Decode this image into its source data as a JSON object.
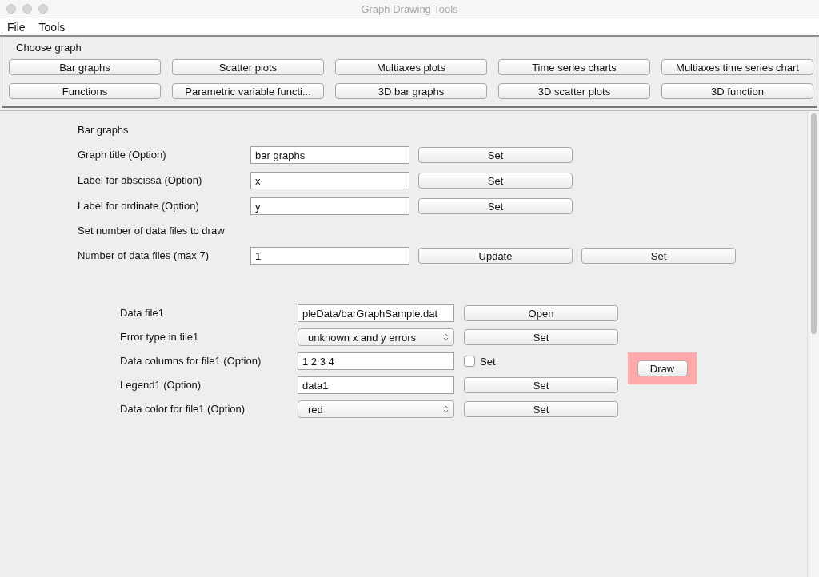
{
  "window": {
    "title": "Graph Drawing Tools"
  },
  "menu": [
    "File",
    "Tools"
  ],
  "choose_graph": {
    "heading": "Choose graph",
    "buttons": [
      "Bar graphs",
      "Scatter plots",
      "Multiaxes plots",
      "Time series charts",
      "Multiaxes time series chart",
      "Functions",
      "Parametric variable functi...",
      "3D bar graphs",
      "3D scatter plots",
      "3D function"
    ]
  },
  "settings": {
    "heading": "Bar graphs",
    "rows": [
      {
        "kind": "field",
        "label": "Graph title (Option)",
        "value": "bar graphs",
        "buttons": [
          "Set"
        ]
      },
      {
        "kind": "field",
        "label": "Label for abscissa (Option)",
        "value": "x",
        "buttons": [
          "Set"
        ]
      },
      {
        "kind": "field",
        "label": "Label for ordinate (Option)",
        "value": "y",
        "buttons": [
          "Set"
        ]
      },
      {
        "kind": "heading",
        "label": "Set number of data files to draw"
      },
      {
        "kind": "field",
        "label": "Number of data files (max 7)",
        "value": "1",
        "buttons": [
          "Update",
          "Set"
        ]
      }
    ]
  },
  "data_files": {
    "rows": [
      {
        "label": "Data file1",
        "field": {
          "kind": "text",
          "value": "pleData/barGraphSample.dat"
        },
        "control": {
          "kind": "button",
          "label": "Open"
        }
      },
      {
        "label": "Error type in file1",
        "field": {
          "kind": "select",
          "value": "unknown x and y errors"
        },
        "control": {
          "kind": "button",
          "label": "Set"
        }
      },
      {
        "label": "Data columns for file1 (Option)",
        "field": {
          "kind": "text",
          "value": "1 2 3 4"
        },
        "control": {
          "kind": "checkbox",
          "label": "Set",
          "checked": false
        }
      },
      {
        "label": "Legend1 (Option)",
        "field": {
          "kind": "text",
          "value": "data1"
        },
        "control": {
          "kind": "button",
          "label": "Set"
        }
      },
      {
        "label": "Data color for file1 (Option)",
        "field": {
          "kind": "select",
          "value": "red"
        },
        "control": {
          "kind": "button",
          "label": "Set"
        }
      }
    ],
    "draw_button": "Draw"
  }
}
